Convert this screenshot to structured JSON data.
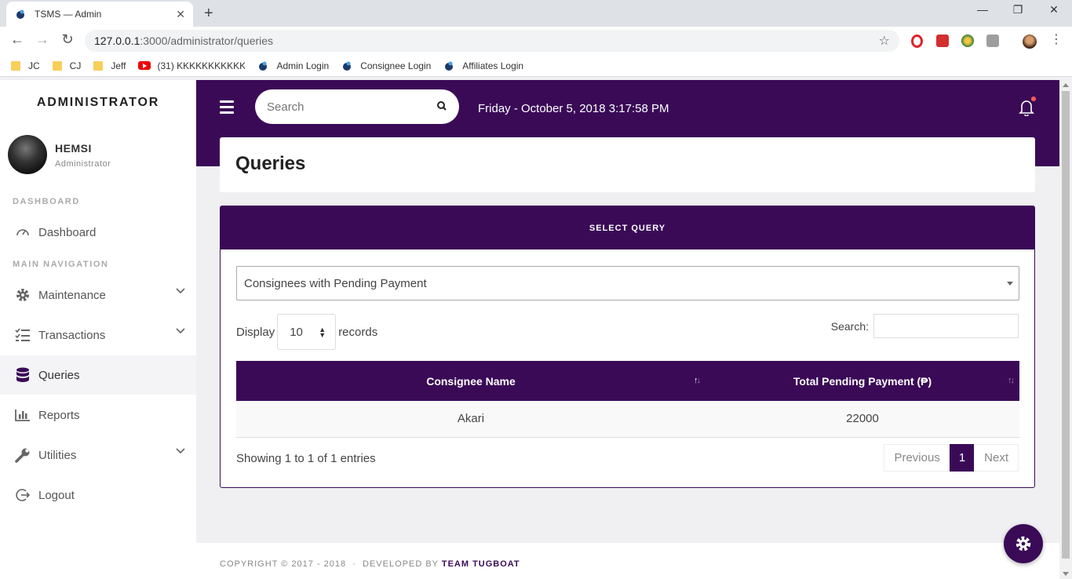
{
  "browser": {
    "tab_title": "TSMS — Admin",
    "new_tab": "+",
    "url_host": "127.0.0.1",
    "url_path": ":3000/administrator/queries",
    "bookmarks": [
      "JC",
      "CJ",
      "Jeff",
      "(31) KKKKKKKKKKKK",
      "Admin Login",
      "Consignee Login",
      "Affiliates Login"
    ]
  },
  "sidebar": {
    "brand": "ADMINISTRATOR",
    "user_name": "HEMSI",
    "user_role": "Administrator",
    "section_dashboard": "DASHBOARD",
    "section_main": "MAIN NAVIGATION",
    "items": [
      "Dashboard",
      "Maintenance",
      "Transactions",
      "Queries",
      "Reports",
      "Utilities",
      "Logout"
    ]
  },
  "header": {
    "search_placeholder": "Search",
    "datetime": "Friday - October 5, 2018 3:17:58 PM"
  },
  "page": {
    "title": "Queries"
  },
  "panel": {
    "heading": "SELECT QUERY",
    "selected_query": "Consignees with Pending Payment",
    "display_label": "Display",
    "display_value": "10",
    "records_label": "records",
    "search_label": "Search:"
  },
  "table": {
    "columns": [
      "Consignee Name",
      "Total Pending Payment (₱)"
    ],
    "rows": [
      [
        "Akari",
        "22000"
      ]
    ],
    "info": "Showing 1 to 1 of 1 entries",
    "prev": "Previous",
    "page": "1",
    "next": "Next"
  },
  "footer": {
    "text": "COPYRIGHT © 2017 - 2018  ·  DEVELOPED BY",
    "team": "TEAM TUGBOAT"
  },
  "colors": {
    "primary": "#3a0a57",
    "notification": "#ff5a5a"
  }
}
